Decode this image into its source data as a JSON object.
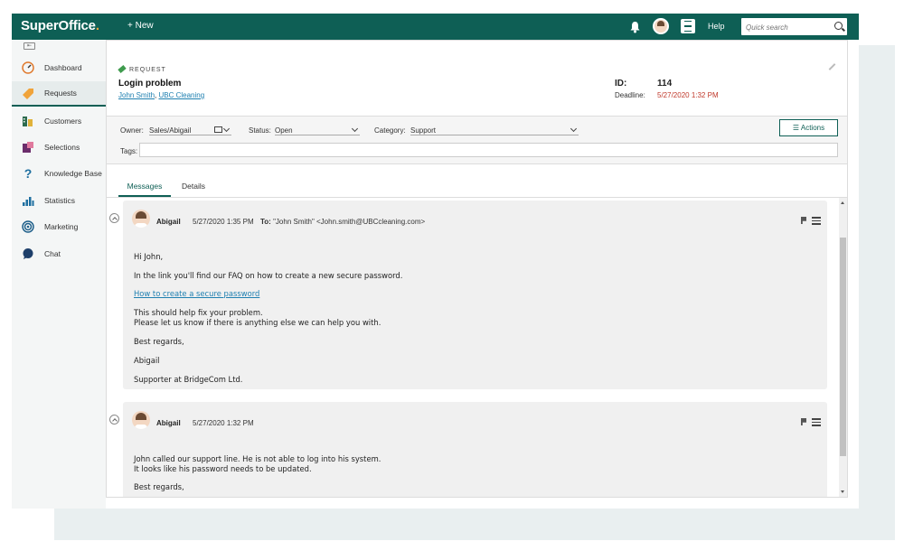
{
  "topbar": {
    "logo": "SuperOffice",
    "logo_dot": ".",
    "new_label": "+ New",
    "help_label": "Help",
    "search_placeholder": "Quick search"
  },
  "sidebar": {
    "items": [
      {
        "label": "Dashboard",
        "icon": "gauge-icon"
      },
      {
        "label": "Requests",
        "icon": "request-tag-icon"
      },
      {
        "label": "Customers",
        "icon": "building-icon"
      },
      {
        "label": "Selections",
        "icon": "selection-icon"
      },
      {
        "label": "Knowledge Base",
        "icon": "question-icon"
      },
      {
        "label": "Statistics",
        "icon": "bar-chart-icon"
      },
      {
        "label": "Marketing",
        "icon": "target-icon"
      },
      {
        "label": "Chat",
        "icon": "chat-bubble-icon"
      }
    ],
    "active": "Requests"
  },
  "request": {
    "type_label": "REQUEST",
    "title": "Login problem",
    "contact": "John Smith",
    "company": "UBC Cleaning",
    "id_label": "ID:",
    "id_value": "114",
    "deadline_label": "Deadline:",
    "deadline_value": "5/27/2020 1:32 PM"
  },
  "fields": {
    "owner_label": "Owner:",
    "owner_value": "Sales/Abigail",
    "status_label": "Status:",
    "status_value": "Open",
    "category_label": "Category:",
    "category_value": "Support",
    "tags_label": "Tags:",
    "actions_label": "☰  Actions"
  },
  "tabs": {
    "messages": "Messages",
    "details": "Details",
    "active": "Messages"
  },
  "messages": [
    {
      "author": "Abigail",
      "date": "5/27/2020 1:35 PM",
      "to_label": "To:",
      "to_value": "\"John Smith\" <John.smith@UBCcleaning.com>",
      "greeting": "Hi John,",
      "line1": "In the link you'll find our FAQ on how to create a new secure password.",
      "link": "How to create a secure password",
      "line2": "This should help fix your problem.",
      "line3": "Please let us know if there is anything else we can help you with.",
      "closing": "Best regards,",
      "signature": "Abigail",
      "signature_title": "Supporter at BridgeCom Ltd."
    },
    {
      "author": "Abigail",
      "date": "5/27/2020 1:32 PM",
      "line1": "John called our support line. He is not able to log into his system.",
      "line2": "It looks like his password needs to be updated.",
      "closing": "Best regards,"
    }
  ],
  "colors": {
    "brand": "#0e5f55",
    "accent": "#f0a33a",
    "link": "#1e7fb0",
    "deadline": "#c0392b"
  }
}
